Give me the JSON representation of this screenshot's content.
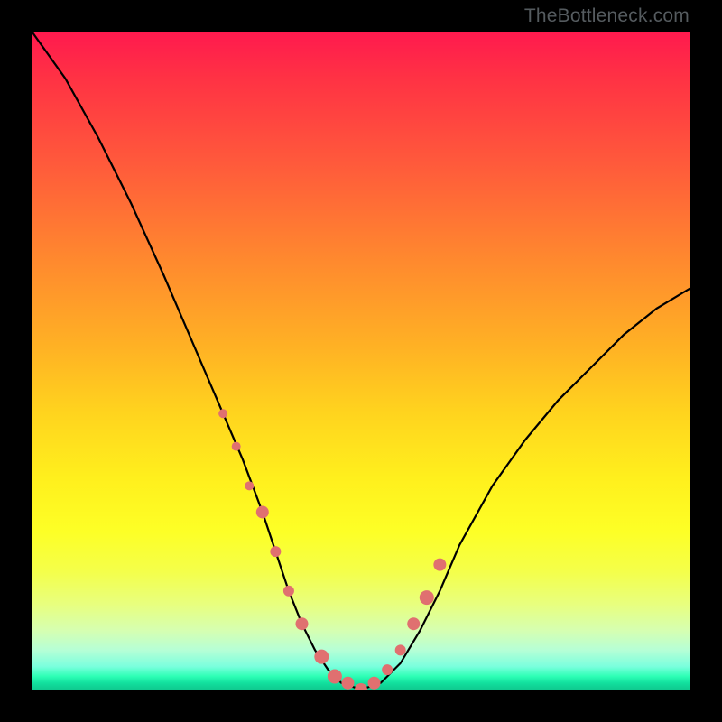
{
  "watermark": "TheBottleneck.com",
  "chart_data": {
    "type": "line",
    "title": "",
    "xlabel": "",
    "ylabel": "",
    "xlim": [
      0,
      100
    ],
    "ylim": [
      0,
      100
    ],
    "series": [
      {
        "name": "curve",
        "x": [
          0,
          5,
          10,
          15,
          20,
          23,
          26,
          29,
          32,
          35,
          37,
          39,
          41,
          43,
          45,
          47,
          50,
          53,
          56,
          59,
          62,
          65,
          70,
          75,
          80,
          85,
          90,
          95,
          100
        ],
        "values": [
          100,
          93,
          84,
          74,
          63,
          56,
          49,
          42,
          35,
          27,
          21,
          15,
          10,
          6,
          3,
          1,
          0,
          1,
          4,
          9,
          15,
          22,
          31,
          38,
          44,
          49,
          54,
          58,
          61
        ]
      }
    ],
    "markers": {
      "name": "highlight-points",
      "color": "#e07070",
      "x": [
        29,
        31,
        33,
        35,
        37,
        39,
        41,
        44,
        46,
        48,
        50,
        52,
        54,
        56,
        58,
        60,
        62
      ],
      "values": [
        42,
        37,
        31,
        27,
        21,
        15,
        10,
        5,
        2,
        1,
        0,
        1,
        3,
        6,
        10,
        14,
        19
      ],
      "radius": [
        5,
        5,
        5,
        7,
        6,
        6,
        7,
        8,
        8,
        7,
        7,
        7,
        6,
        6,
        7,
        8,
        7
      ]
    }
  }
}
